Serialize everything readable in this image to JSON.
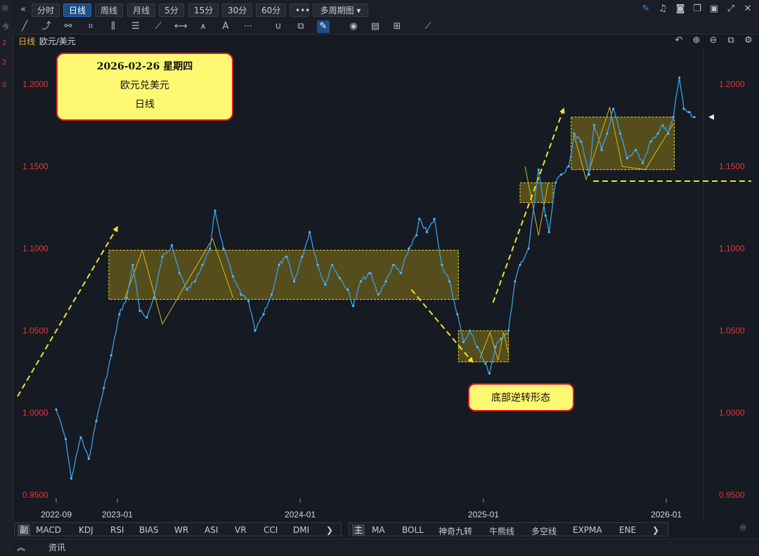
{
  "toolbar": {
    "collapse_icon": "double-chevron-left-icon",
    "periods": [
      "分时",
      "日线",
      "周线",
      "月线",
      "5分",
      "15分",
      "30分",
      "60分"
    ],
    "active_period": "日线",
    "more_label": "•••",
    "multi_period_label": "多周期图",
    "right_icons": [
      "pen-icon",
      "bell-icon",
      "camera-icon",
      "copy-icon",
      "monitor-icon",
      "expand-icon",
      "close-icon"
    ]
  },
  "drawing_tools": [
    "line-icon",
    "ray-icon",
    "polyline-icon",
    "crop-icon",
    "parallel-icon",
    "fib-icon",
    "gann-icon",
    "range-icon",
    "pitchfork-icon",
    "text-icon",
    "more-icon",
    "magnet-icon",
    "layers-icon",
    "pencil-icon",
    "eye-icon",
    "trash-icon",
    "grid-icon",
    "ruler-icon"
  ],
  "chart_label": {
    "period": "日线",
    "symbol": "欧元/美元"
  },
  "chart_controls": [
    "undo-icon",
    "zoom-in-icon",
    "zoom-out-icon",
    "layout-icon",
    "settings-icon"
  ],
  "left_strip": [
    "◎",
    "今",
    "2",
    "2",
    "0"
  ],
  "callout_top": {
    "line1": "2026-02-26 星期四",
    "line2": "欧元兑美元",
    "line3": "日线"
  },
  "callout_bottom": "底部逆转形态",
  "colors": {
    "price": "#3aa0e8",
    "box_border": "#e6d43a",
    "box_fill": "#8a7a18",
    "arrow": "#f1e22c",
    "axis_text": "#e0373a",
    "callout_bg": "#fff873",
    "callout_border": "#d9202a"
  },
  "chart_data": {
    "type": "line",
    "title": "",
    "xlabel": "",
    "ylabel": "",
    "ylim": [
      0.95,
      1.205
    ],
    "y_ticks": [
      "1.2000",
      "1.1500",
      "1.1000",
      "1.0500",
      "1.0000",
      "0.9500"
    ],
    "x_ticks": [
      "2022-09",
      "2023-01",
      "2024-01",
      "2025-01",
      "2026-01"
    ],
    "series": [
      {
        "x": [
          "2022-09-01",
          "2022-09-20",
          "2022-10-01",
          "2022-10-20",
          "2022-11-05",
          "2022-11-20",
          "2022-12-05",
          "2022-12-20",
          "2023-01-05",
          "2023-01-20",
          "2023-02-01",
          "2023-02-15",
          "2023-03-01",
          "2023-03-15",
          "2023-04-01",
          "2023-04-20",
          "2023-05-05",
          "2023-05-20",
          "2023-06-05",
          "2023-06-20",
          "2023-07-05",
          "2023-07-15",
          "2023-08-01",
          "2023-08-20",
          "2023-09-05",
          "2023-09-20",
          "2023-10-03",
          "2023-10-20",
          "2023-11-05",
          "2023-11-20",
          "2023-12-05",
          "2023-12-20",
          "2024-01-05",
          "2024-01-20",
          "2024-02-05",
          "2024-02-20",
          "2024-03-05",
          "2024-03-20",
          "2024-04-05",
          "2024-04-16",
          "2024-05-01",
          "2024-05-20",
          "2024-06-05",
          "2024-06-20",
          "2024-07-05",
          "2024-07-20",
          "2024-08-05",
          "2024-08-20",
          "2024-08-26",
          "2024-09-10",
          "2024-09-25",
          "2024-10-10",
          "2024-10-25",
          "2024-11-10",
          "2024-11-22",
          "2024-12-05",
          "2024-12-20",
          "2025-01-05",
          "2025-01-13",
          "2025-01-25",
          "2025-02-05",
          "2025-02-20",
          "2025-03-05",
          "2025-03-15",
          "2025-04-01",
          "2025-04-21",
          "2025-05-05",
          "2025-05-12",
          "2025-05-25",
          "2025-06-05",
          "2025-06-20",
          "2025-07-01",
          "2025-07-15",
          "2025-07-31",
          "2025-08-10",
          "2025-08-25",
          "2025-09-05",
          "2025-09-17",
          "2025-10-01",
          "2025-10-15",
          "2025-11-01",
          "2025-11-15",
          "2025-12-01",
          "2025-12-15",
          "2025-12-25",
          "2026-01-05",
          "2026-01-15",
          "2026-01-27",
          "2026-02-05",
          "2026-02-15",
          "2026-02-26"
        ],
        "y": [
          1.002,
          0.984,
          0.96,
          0.985,
          0.972,
          0.995,
          1.015,
          1.035,
          1.06,
          1.07,
          1.09,
          1.062,
          1.058,
          1.07,
          1.095,
          1.102,
          1.085,
          1.075,
          1.08,
          1.09,
          1.1,
          1.123,
          1.1,
          1.083,
          1.072,
          1.068,
          1.05,
          1.06,
          1.072,
          1.09,
          1.095,
          1.08,
          1.095,
          1.11,
          1.09,
          1.078,
          1.09,
          1.082,
          1.075,
          1.065,
          1.08,
          1.085,
          1.072,
          1.08,
          1.09,
          1.085,
          1.1,
          1.108,
          1.118,
          1.11,
          1.118,
          1.09,
          1.08,
          1.06,
          1.043,
          1.05,
          1.04,
          1.03,
          1.024,
          1.04,
          1.045,
          1.05,
          1.08,
          1.09,
          1.1,
          1.148,
          1.12,
          1.11,
          1.14,
          1.145,
          1.15,
          1.17,
          1.165,
          1.145,
          1.175,
          1.16,
          1.17,
          1.185,
          1.17,
          1.155,
          1.16,
          1.152,
          1.165,
          1.17,
          1.175,
          1.17,
          1.18,
          1.204,
          1.185,
          1.183,
          1.18
        ]
      }
    ],
    "last_price": 1.18
  },
  "bottom_indicators": {
    "sub_tag": "副",
    "sub": [
      "MACD",
      "KDJ",
      "RSI",
      "BIAS",
      "WR",
      "ASI",
      "VR",
      "CCI",
      "DMI"
    ],
    "main_tag": "主",
    "main": [
      "MA",
      "BOLL",
      "神奇九转",
      "牛熊线",
      "多空线",
      "EXPMA",
      "ENE"
    ],
    "more_icon": "chevron-right-icon",
    "location_icon": "location-icon"
  },
  "footer": {
    "collapse_icon": "double-chevron-up-icon",
    "tab": "资讯"
  }
}
